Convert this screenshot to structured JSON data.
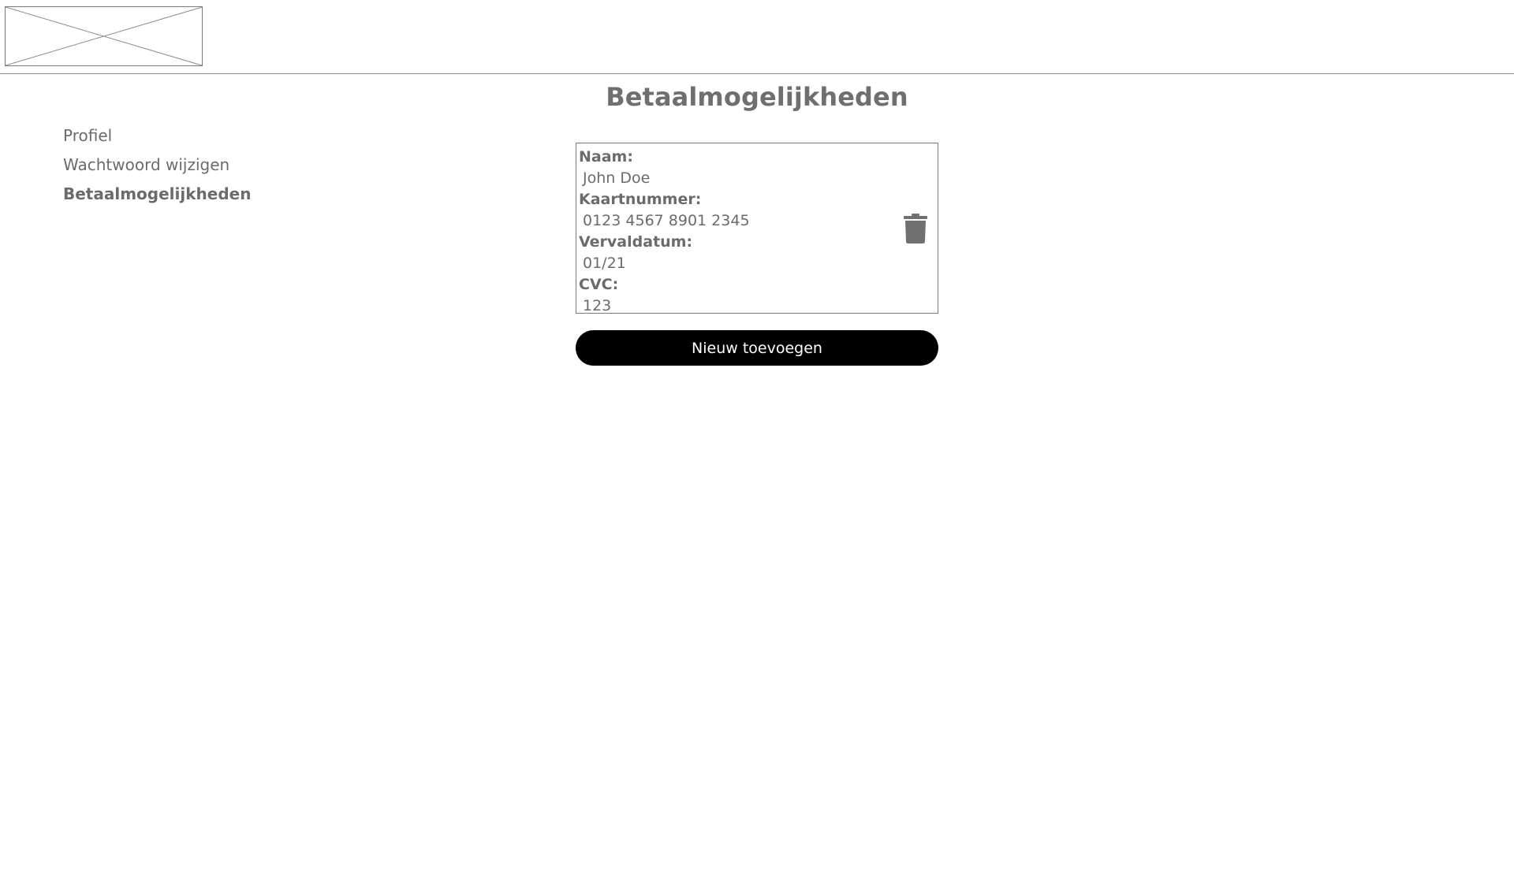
{
  "header": {
    "logo_icon": "image-placeholder-icon"
  },
  "page": {
    "title": "Betaalmogelijkheden"
  },
  "sidebar": {
    "items": [
      {
        "label": "Profiel",
        "active": false
      },
      {
        "label": "Wachtwoord wijzigen",
        "active": false
      },
      {
        "label": "Betaalmogelijkheden",
        "active": true
      }
    ]
  },
  "payment_card": {
    "fields": [
      {
        "label": "Naam:",
        "value": "John Doe"
      },
      {
        "label": "Kaartnummer:",
        "value": "0123 4567 8901 2345"
      },
      {
        "label": "Vervaldatum:",
        "value": "01/21"
      },
      {
        "label": "CVC:",
        "value": "123"
      }
    ],
    "delete_icon": "trash-icon"
  },
  "actions": {
    "add_new_label": "Nieuw toevoegen"
  },
  "colors": {
    "text": "#6b6b6b",
    "button_bg": "#000000",
    "button_text": "#ffffff",
    "border": "#7a7a7a"
  }
}
